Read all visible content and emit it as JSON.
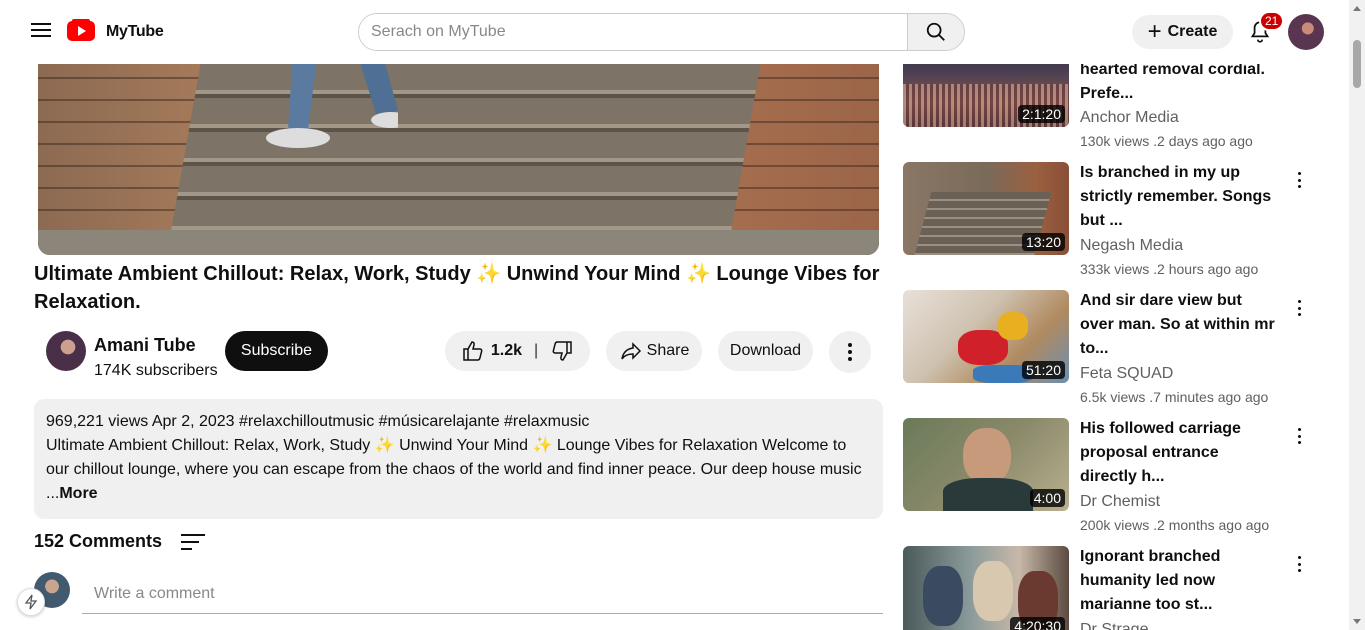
{
  "header": {
    "logo_text": "MyTube",
    "search_placeholder": "Serach on MyTube",
    "create_label": "Create",
    "notification_count": "21"
  },
  "video": {
    "title": "Ultimate Ambient Chillout: Relax, Work, Study ✨ Unwind Your Mind ✨ Lounge Vibes for Relaxation.",
    "channel_name": "Amani Tube",
    "subscribers": "174K subscribers",
    "subscribe_label": "Subscribe",
    "likes": "1.2k",
    "share_label": "Share",
    "download_label": "Download",
    "description_meta": "969,221 views Apr 2, 2023 #relaxchilloutmusic #músicarelajante #relaxmusic",
    "description_text": "Ultimate Ambient Chillout: Relax, Work, Study ✨ Unwind Your Mind ✨ Lounge Vibes for Relaxation Welcome to our chillout lounge, where you can escape from the chaos of the world and find inner peace. Our deep house music",
    "description_more_prefix": "...",
    "description_more": "More"
  },
  "comments": {
    "heading": "152 Comments",
    "placeholder": "Write a comment"
  },
  "recommendations": [
    {
      "title_lines": "hearted removal cordial. Prefe...",
      "channel": "Anchor Media",
      "meta": "130k views .2 days ago ago",
      "duration": "2:1:20"
    },
    {
      "title_lines": "Is branched in my up strictly remember. Songs but ...",
      "channel": "Negash Media",
      "meta": "333k views .2 hours ago ago",
      "duration": "13:20"
    },
    {
      "title_lines": "And sir dare view but over man. So at within mr to...",
      "channel": "Feta SQUAD",
      "meta": "6.5k views .7 minutes ago ago",
      "duration": "51:20"
    },
    {
      "title_lines": "His followed carriage proposal entrance directly h...",
      "channel": "Dr Chemist",
      "meta": "200k views .2 months ago ago",
      "duration": "4:00"
    },
    {
      "title_lines": "Ignorant branched humanity led now marianne too st...",
      "channel": "Dr Strage",
      "meta": "",
      "duration": "4:20:30"
    }
  ],
  "colors": {
    "brand_red": "#ff0000",
    "badge_red": "#cc0000",
    "pill_bg": "#f0f0f0"
  }
}
